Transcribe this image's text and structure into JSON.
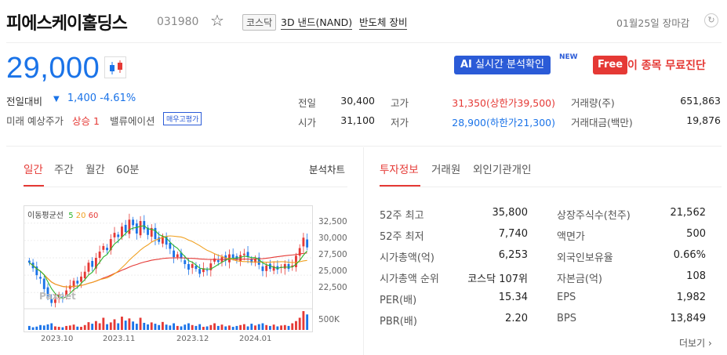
{
  "header": {
    "title": "피에스케이홀딩스",
    "code": "031980",
    "market": "코스닥",
    "themes": [
      "3D 낸드(NAND)",
      "반도체 장비"
    ],
    "date": "01월25일 장마감"
  },
  "price": {
    "current": "29,000",
    "change_label": "전일대비",
    "change_arrow": "▼",
    "change_value": "1,400",
    "change_pct": "-4.61%",
    "predict_label": "미래 예상주가",
    "predict_value": "상승 1",
    "valuation_label": "밸류에이션",
    "valuation_badge": "매우고평가"
  },
  "buttons": {
    "ai_prefix": "AI",
    "ai_label": "실시간 분석확인",
    "new_badge": "NEW",
    "free_badge": "Free",
    "free_label": "이 종목 무료진단"
  },
  "quote": {
    "prev_label": "전일",
    "prev": "30,400",
    "open_label": "시가",
    "open": "31,100",
    "high_label": "고가",
    "high": "31,350(상한가39,500)",
    "low_label": "저가",
    "low": "28,900(하한가21,300)",
    "vol_label": "거래량(주)",
    "vol": "651,863",
    "amt_label": "거래대금(백만)",
    "amt": "19,876"
  },
  "chart_tabs": [
    "일간",
    "주간",
    "월간",
    "60분"
  ],
  "chart_link": "분석차트",
  "info_tabs": [
    "투자정보",
    "거래원",
    "외인기관개인"
  ],
  "colors": {
    "up": "#e53935",
    "down": "#1a73e8",
    "ma5": "#2db52d",
    "ma20": "#f0a020",
    "ma60": "#e53935"
  },
  "chart_data": {
    "type": "candlestick",
    "ma_label": "이동평균선",
    "ma_periods": [
      "5",
      "20",
      "60"
    ],
    "y_ticks": [
      "32,500",
      "30,000",
      "27,500",
      "25,000",
      "22,500"
    ],
    "y_tick_values": [
      32500,
      30000,
      27500,
      25000,
      22500
    ],
    "ylim": [
      20500,
      34500
    ],
    "volume_tick": "500K",
    "x_ticks": [
      "2023.10",
      "2023.11",
      "2023.12",
      "2024.01"
    ],
    "watermark": "Paxnet",
    "close": [
      26800,
      26000,
      25000,
      24500,
      23000,
      21800,
      21000,
      21500,
      22200,
      21900,
      22800,
      23500,
      24200,
      23800,
      24800,
      25500,
      26800,
      26200,
      27500,
      28400,
      29200,
      28600,
      30200,
      31100,
      30500,
      32000,
      31200,
      33000,
      32200,
      31000,
      32800,
      31600,
      30800,
      31800,
      30200,
      29800,
      30600,
      29400,
      28800,
      27600,
      28000,
      27400,
      26600,
      25800,
      26600,
      25900,
      25200,
      26000,
      25700,
      26700,
      27400,
      26900,
      27600,
      27100,
      28000,
      27500,
      27200,
      27900,
      28100,
      27600,
      26800,
      27300,
      26500,
      25600,
      26400,
      25900,
      26300,
      25800,
      26200,
      26600,
      25900,
      26400,
      27800,
      28900,
      30400,
      29000
    ],
    "volume": [
      18,
      12,
      15,
      22,
      20,
      25,
      30,
      16,
      14,
      12,
      18,
      20,
      24,
      15,
      14,
      22,
      35,
      28,
      40,
      30,
      55,
      26,
      34,
      48,
      30,
      60,
      42,
      52,
      38,
      28,
      55,
      32,
      25,
      34,
      28,
      22,
      36,
      24,
      20,
      30,
      18,
      16,
      24,
      30,
      22,
      18,
      26,
      14,
      16,
      22,
      30,
      18,
      24,
      16,
      20,
      14,
      18,
      22,
      26,
      16,
      28,
      20,
      26,
      30,
      22,
      18,
      24,
      16,
      20,
      22,
      18,
      30,
      40,
      55,
      85,
      70
    ]
  },
  "invest_info": {
    "left": [
      {
        "label": "52주 최고",
        "value": "35,800"
      },
      {
        "label": "52주 최저",
        "value": "7,740"
      },
      {
        "label": "시가총액(억)",
        "value": "6,253"
      },
      {
        "label": "시가총액 순위",
        "value": "코스닥 107위"
      },
      {
        "label": "PER(배)",
        "value": "15.34"
      },
      {
        "label": "PBR(배)",
        "value": "2.20"
      }
    ],
    "right": [
      {
        "label": "상장주식수(천주)",
        "value": "21,562"
      },
      {
        "label": "액면가",
        "value": "500"
      },
      {
        "label": "외국인보유율",
        "value": "0.66%"
      },
      {
        "label": "자본금(억)",
        "value": "108"
      },
      {
        "label": "EPS",
        "value": "1,982"
      },
      {
        "label": "BPS",
        "value": "13,849"
      }
    ],
    "more": "더보기"
  }
}
